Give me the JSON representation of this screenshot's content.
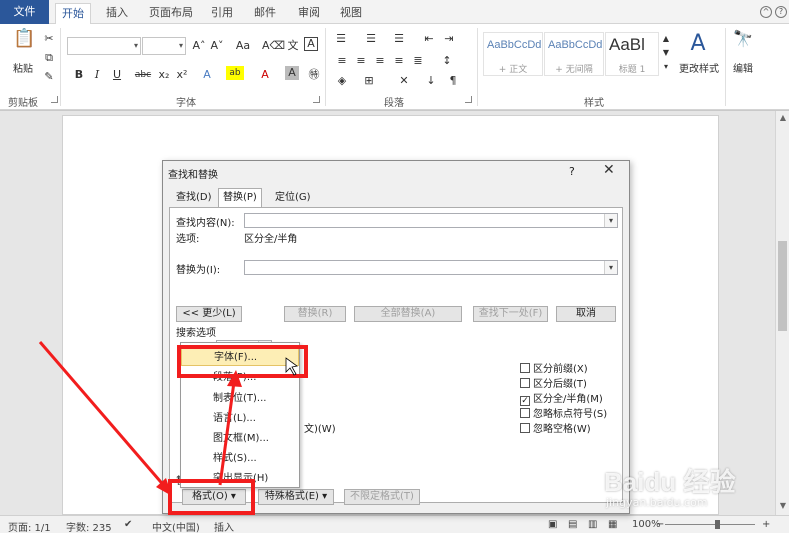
{
  "ribbon_tabs": [
    "文件",
    "开始",
    "插入",
    "页面布局",
    "引用",
    "邮件",
    "审阅",
    "视图"
  ],
  "groups": {
    "clipboard": {
      "label": "剪贴板",
      "paste_label": "粘贴"
    },
    "font": {
      "label": "字体"
    },
    "paragraph": {
      "label": "段落"
    },
    "styles": {
      "label": "样式",
      "items": [
        {
          "preview": "AaBbCcDd",
          "name": "+ 正文"
        },
        {
          "preview": "AaBbCcDd",
          "name": "+ 无间隔"
        },
        {
          "preview": "AaBl",
          "name": "标题 1"
        }
      ],
      "change_styles": "更改样式"
    },
    "editing": {
      "label": "编辑"
    }
  },
  "dialog": {
    "title": "查找和替换",
    "help": "?",
    "close": "✕",
    "tabs": [
      "查找(D)",
      "替换(P)",
      "定位(G)"
    ],
    "find_label": "查找内容(N):",
    "options_label": "选项:",
    "options_value": "区分全/半角",
    "replace_label": "替换为(I):",
    "buttons": {
      "less": "<< 更少(L)",
      "replace": "替换(R)",
      "replace_all": "全部替换(A)",
      "find_next": "查找下一处(F)",
      "cancel": "取消"
    },
    "search_options": "搜索选项",
    "right_checks": [
      {
        "label": "区分前缀(X)",
        "checked": false
      },
      {
        "label": "区分后缀(T)",
        "checked": false
      },
      {
        "label": "区分全/半角(M)",
        "checked": true
      },
      {
        "label": "忽略标点符号(S)",
        "checked": false
      },
      {
        "label": "忽略空格(W)",
        "checked": false
      }
    ],
    "partial_left": "文)(W)",
    "replace_section": "替",
    "bottom_buttons": {
      "format": "格式(O) ▾",
      "special": "特殊格式(E) ▾",
      "no_format": "不限定格式(T)"
    }
  },
  "format_menu": [
    "字体(F)...",
    "段落(P)...",
    "制表位(T)...",
    "语言(L)...",
    "图文框(M)...",
    "样式(S)...",
    "突出显示(H)"
  ],
  "statusbar": {
    "page": "页面: 1/1",
    "words": "字数: 235",
    "language": "中文(中国)",
    "insert": "插入",
    "zoom": "100%",
    "minus": "−",
    "plus": "+"
  },
  "watermark": {
    "main": "Baidu 经验",
    "sub": "jingyan.baidu.com"
  },
  "colors": {
    "file_tab": "#2b579a",
    "annotation": "#f21d1d",
    "highlight": "#fdeeb5"
  }
}
